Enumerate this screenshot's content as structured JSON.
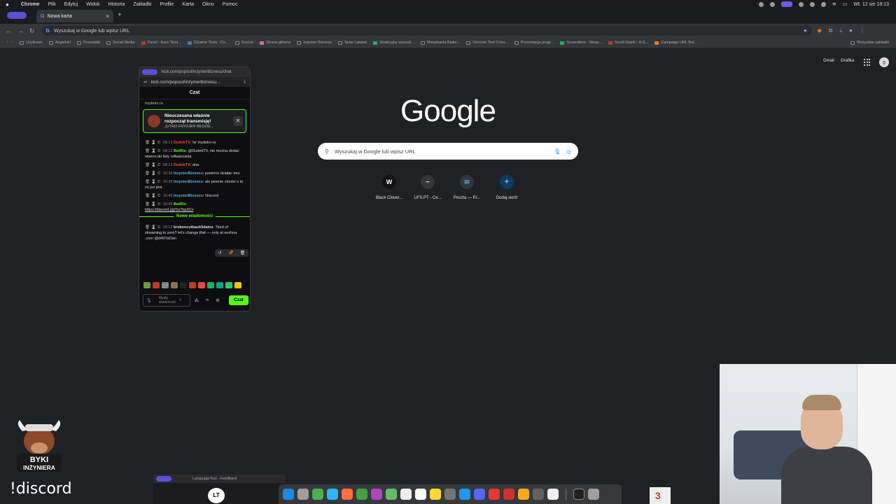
{
  "menubar": {
    "app": "Chrome",
    "items": [
      "Plik",
      "Edytuj",
      "Widok",
      "Historia",
      "Zakładki",
      "Profile",
      "Karta",
      "Okno",
      "Pomoc"
    ],
    "clock": "Wt. 12 sie 18:13"
  },
  "tab": {
    "title": "Nowa karta"
  },
  "toolbar": {
    "omnibox_placeholder": "Wyszukaj w Google lub wpisz URL"
  },
  "bookmarks": {
    "items": [
      "Uzytkowe",
      "Angielski",
      "Pozostałe",
      "Social Media",
      "Panel - Kurs \"Bud...",
      "OGame Tools - Co...",
      "Source",
      "Strona główna",
      "Inżynier Biznesu",
      "Tanie Latanie",
      "Atrakcyjny wyszuk...",
      "Mieszkania Białor...",
      "Unicode Text Conv...",
      "Prezentacja progr...",
      "Screentime - Meas...",
      "Scroll Depth - A G...",
      "Campaign URL Bui..."
    ],
    "all": "Wszystkie zakładki"
  },
  "google": {
    "gmail": "Gmail",
    "images": "Grafika",
    "avatar_letter": "g",
    "logo": "Google",
    "search_placeholder": "Wyszukaj w Google lub wpisz URL",
    "shortcuts": [
      {
        "label": "Black Clover...",
        "glyph": "W"
      },
      {
        "label": "UFS.PT - Ce...",
        "glyph": "~"
      },
      {
        "label": "Poczta — Pi...",
        "glyph": "✉"
      },
      {
        "label": "Dodaj skrót",
        "glyph": "+"
      }
    ]
  },
  "popup": {
    "titlebar": "kick.com/popout/inzynierbiznesu/chat",
    "url": "kick.com/popout/inzynierbiznesu...",
    "header": "Czat",
    "top_partial": "mydeko ra",
    "notification": {
      "title": "Nieuczesana właśnie rozpoczął transmisję!",
      "subtitle": "JUTRO FRYZJER BEDZIE..."
    },
    "messages": [
      {
        "time": "08:13",
        "user": "DudekTV",
        "user_color": "red",
        "text": ": !sr mydeko ra"
      },
      {
        "time": "08:13",
        "user": "BotRix",
        "user_color": "green",
        "text": ": @DudekTV, nie można dodać utworu do listy odtwarzania."
      },
      {
        "time": "08:13",
        "user": "DudekTV",
        "user_color": "red",
        "text": ": aha"
      },
      {
        "time": "16:38",
        "user": "InzynierBiznesu",
        "user_color": "blue",
        "text": ": powinno działac imo"
      },
      {
        "time": "16:38",
        "user": "InzynierBiznesu",
        "user_color": "blue",
        "text": ": ale pewnie chodzi o to ze juz jest"
      },
      {
        "time": "16:48",
        "user": "InzynierBiznesu",
        "user_color": "blue",
        "text": ": !discord"
      },
      {
        "time": "16:48",
        "user": "BotRix",
        "user_color": "green",
        "text": ":",
        "link": "https://discord.gg/Sa7bp2Cn"
      }
    ],
    "new_messages": "Nowe wiadomości",
    "last_message": {
      "time": "18:12",
      "user": "brokencutback5dams",
      "text": ": Tired of streaming to zero? let's change that — only at nezhna .com @d40YaOan"
    },
    "input_placeholder": "Wyślij wiadomość",
    "chat_button": "Czat",
    "tools_label": "∞"
  },
  "overlay": {
    "discord_text": "!discord",
    "byki_line1": "BYKI",
    "byki_line2": "INŻYNIERA"
  },
  "languagetool": {
    "title": "LanguageTool - Feedback",
    "logo": "LT"
  },
  "dock_badge": "3",
  "colors": {
    "kick_green": "#53fc18",
    "accent_purple": "#5b4fd6",
    "bg": "#202124"
  }
}
